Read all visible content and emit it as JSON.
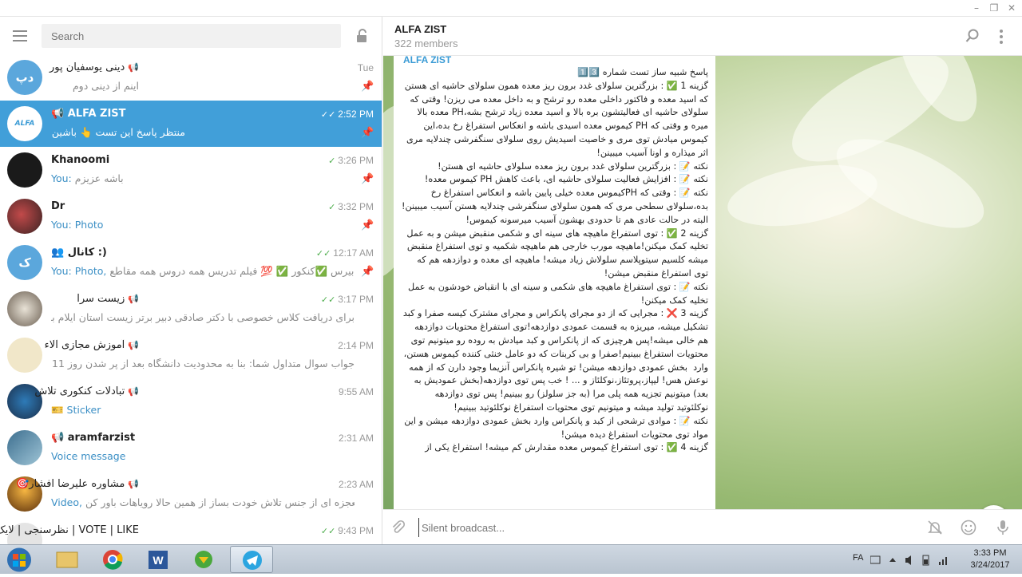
{
  "window": {
    "minimize": "–",
    "maximize": "❐",
    "close": "✕"
  },
  "sidebar": {
    "search_placeholder": "Search",
    "chats": [
      {
        "name": "دینی یوسفیان پور",
        "time": "Tue",
        "preview": "اینم از دینی دوم",
        "avatar_text": "دپ",
        "avatar_color": "#5ba7dc",
        "pinned": true
      },
      {
        "name": "ALFA ZIST",
        "time": "2:52 PM",
        "preview": "منتظر پاسخ این تست 👆 باشین",
        "avatar_text": "ALFA",
        "pinned": true,
        "active": true
      },
      {
        "name": "Khanoomi",
        "time": "3:26 PM",
        "preview_you": "You:",
        "preview": "باشه عزیزم",
        "pinned": true
      },
      {
        "name": "Dr",
        "time": "3:32 PM",
        "preview_you": "You:",
        "preview": "Photo",
        "pinned": true
      },
      {
        "name": "کانال :)",
        "time": "12:17 AM",
        "preview_you": "You: Photo,",
        "preview": "دبیرس ✅کنکور ✅ 💯 فیلم تدریس همه دروس همه مقاطع...",
        "avatar_text": "ک",
        "avatar_color": "#5ba7dc",
        "pinned": true
      },
      {
        "name": "زیست سرا",
        "time": "3:17 PM",
        "preview": "برای دریافت کلاس خصوصی با دکتر صادقی دبیر برتر زیست استان ایلام با این آی..."
      },
      {
        "name": "آموزش مجازی آلاء",
        "time": "2:14 PM",
        "preview": "جواب سوال متداول شما: بنا به محدودیت دانشگاه بعد از پر شدن روز 11 هم دیگه..."
      },
      {
        "name": "تبادلات کنکوری تلاش",
        "time": "9:55 AM",
        "preview": "🎫 Sticker"
      },
      {
        "name": "aramfarzist",
        "time": "2:31 AM",
        "preview": "Voice message"
      },
      {
        "name": "مشاوره علیرضا افشار🎯",
        "time": "2:23 AM",
        "preview_you": "Video,",
        "preview": "امس معجزه ای از جنس تلاش خودت بساز از همین حالا رویاهات باور کن"
      },
      {
        "name": "VOTE | LIKE | نظرسنجی | لایک",
        "time": "9:43 PM",
        "preview": ""
      }
    ]
  },
  "chat": {
    "title": "ALFA ZIST",
    "subtitle": "322 members",
    "sender": "ALFA ZIST",
    "message": [
      "پاسخ شبیه ساز تست شماره 1️⃣3️⃣",
      "",
      "گزینه 1 ✅ : بزرگترین سلولای غدد برون ریز معده همون سلولای حاشیه ای هستن که اسید معده و فاکتور داخلی معده رو ترشح و به داخل معده می ریزن! وقتی که سلولای حاشیه ای فعالیتشون بره بالا و اسید معده زیاد ترشح بشه،PH معده بالا میره و وقتی که PH کیموس معده اسیدی باشه و انعکاس استفراغ رخ بده،این کیموس میادش توی مری و خاصیت اسیدیش روی سلولای سنگفرشی چندلایه مری اثر میذاره و اونا آسیب میبینن!",
      "نکته 📝 : بزرگترین سلولای غدد برون ریز معده سلولای حاشیه ای هستن!",
      "نکته 📝 : افزایش فعالیت سلولای حاشیه ای، باعث کاهش PH کیموس معده!",
      "نکته 📝 : وقتی که PHکیموس معده خیلی پایین باشه و انعکاس استفراغ رخ بده،سلولای سطحی مری که همون سلولای سنگفرشی چندلایه هستن آسیب میبینن!البته در حالت عادی هم تا حدودی بهشون آسیب میرسونه کیموس!",
      "گزینه 2 ✅ : توی استفراغ ماهیچه های سینه ای و شکمی منقبض میشن و به عمل تخلیه کمک میکنن!ماهیچه مورب خارجی هم ماهیچه شکمیه و توی استفراغ منقبض میشه کلسیم سیتوپلاسم سلولاش زیاد میشه! ماهیچه ای معده و دوازدهه هم که توی استفراغ منقبض میشن!",
      "نکته 📝 : توی استفراغ ماهیچه های شکمی و سینه ای با انقباض خودشون به عمل تخلیه کمک میکنن!",
      "گزینه 3 ❌ : مجرایی که از دو مجرای پانکراس و مجرای مشترک کیسه صفرا و کبد تشکیل میشه، میریزه به قسمت عمودی دوازدهه!توی استفراغ محتویات دوازدهه هم خالی میشه!پس هرچیزی که از پانکراس و کبد میادش به روده رو میتونیم توی محتویات استفراغ ببینیم!صفرا و بی کربنات که دو عامل خنثی کننده کیموس هستن، وارد  بخش عمودی دوازدهه میشن! تو شیره پانکراس آنزیما وجود دارن که از همه نوعش هس! لیپاز،پروتئاز،نوکلئاز و ... ! خب پس توی دوازدهه(بخش عمودیش به بعد) میتونیم تجزیه همه پلی مرا (به جز سلولز) رو ببینیم! پس توی دوازدهه نوکلئوتید تولید میشه و میتونیم توی محتویات استفراغ نوکلئوتید ببینیم!",
      "نکته 📝 : موادی ترشحی از کبد و پانکراس وارد بخش عمودی دوازدهه میشن و این مواد توی محتویات استفراغ دیده میشن!",
      "گزینه 4 ✅ : توی استفراغ کیموس معده مقدارش کم میشه! استفراغ یکی از"
    ],
    "composer_placeholder": "Silent broadcast..."
  },
  "taskbar": {
    "lang": "FA",
    "time": "3:33 PM",
    "date": "3/24/2017"
  }
}
